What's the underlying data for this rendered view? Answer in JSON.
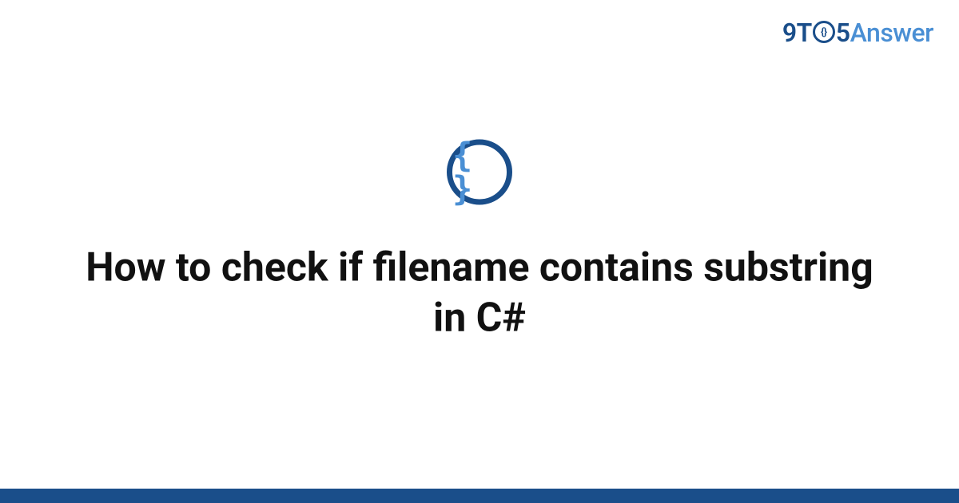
{
  "logo": {
    "part1": "9T",
    "part_o_inner": "{}",
    "part2": "5",
    "part3": "Answer"
  },
  "icon": {
    "braces": "{ }"
  },
  "title": "How to check if filename contains substring in C#",
  "colors": {
    "primary": "#1a4e8a",
    "accent": "#4a8fd4"
  }
}
